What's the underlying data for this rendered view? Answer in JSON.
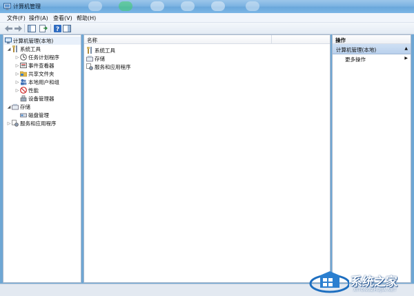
{
  "window": {
    "title": "计算机管理"
  },
  "menu": [
    {
      "label": "文件(F)"
    },
    {
      "label": "操作(A)"
    },
    {
      "label": "查看(V)"
    },
    {
      "label": "帮助(H)"
    }
  ],
  "tree": {
    "root": "计算机管理(本地)",
    "system_tools": "系统工具",
    "task_scheduler": "任务计划程序",
    "event_viewer": "事件查看器",
    "shared_folders": "共享文件夹",
    "local_users_groups": "本地用户和组",
    "performance": "性能",
    "device_manager": "设备管理器",
    "storage": "存储",
    "disk_management": "磁盘管理",
    "services_apps": "服务和应用程序"
  },
  "center": {
    "column_name": "名称",
    "items": [
      {
        "label": "系统工具"
      },
      {
        "label": "存储"
      },
      {
        "label": "服务和应用程序"
      }
    ]
  },
  "actions": {
    "header": "操作",
    "section": "计算机管理(本地)",
    "more": "更多操作"
  },
  "watermark": {
    "text": "系统之家",
    "url": "XITONGZHUJIA.NET"
  },
  "colors": {
    "title_bar": "#7db4e2",
    "selection": "#cfe0f4",
    "pane_border": "#a8b7cb"
  }
}
